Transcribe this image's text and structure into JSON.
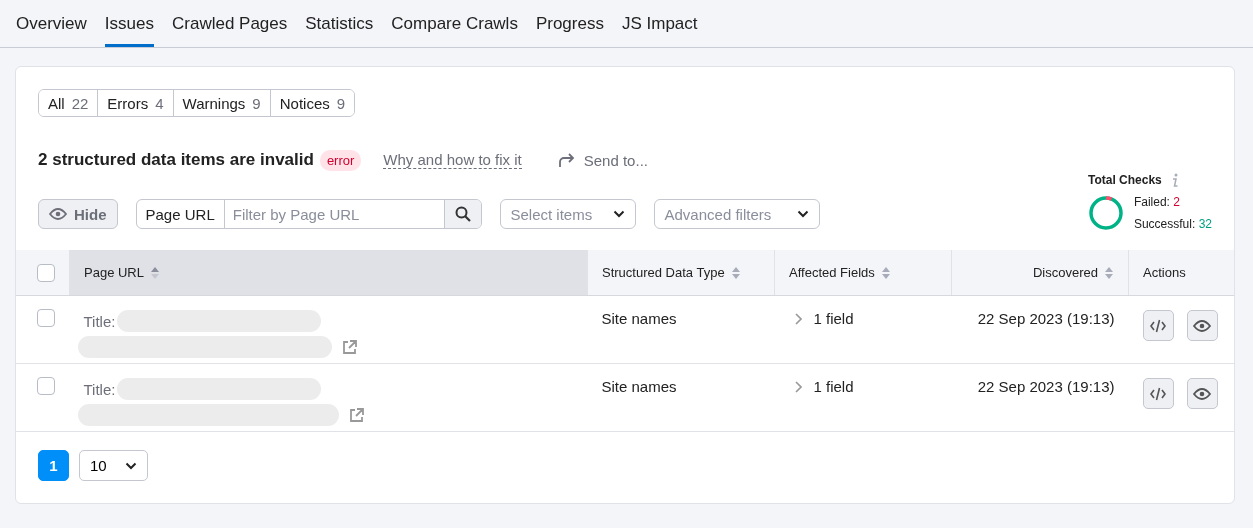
{
  "tabs": [
    {
      "label": "Overview",
      "selected": false
    },
    {
      "label": "Issues",
      "selected": true
    },
    {
      "label": "Crawled Pages",
      "selected": false
    },
    {
      "label": "Statistics",
      "selected": false
    },
    {
      "label": "Compare Crawls",
      "selected": false
    },
    {
      "label": "Progress",
      "selected": false
    },
    {
      "label": "JS Impact",
      "selected": false
    }
  ],
  "segments": [
    {
      "label": "All",
      "count": "22",
      "selected": false
    },
    {
      "label": "Errors",
      "count": "4",
      "selected": false
    },
    {
      "label": "Warnings",
      "count": "9",
      "selected": false
    },
    {
      "label": "Notices",
      "count": "9",
      "selected": false
    }
  ],
  "issue": {
    "title": "2 structured data items are invalid",
    "badge": "error",
    "help_link": "Why and how to fix it",
    "send_to": "Send to..."
  },
  "filters": {
    "hide_button": "Hide",
    "url_filter_label": "Page URL",
    "url_filter_placeholder": "Filter by Page URL",
    "select_placeholder": "Select items",
    "advanced_filters": "Advanced filters"
  },
  "total_checks": {
    "title": "Total Checks",
    "failed_label": "Failed:",
    "failed": "2",
    "successful_label": "Successful:",
    "successful": "32"
  },
  "table": {
    "columns": [
      {
        "label": "Page URL",
        "sortable": true,
        "active": true
      },
      {
        "label": "Structured Data Type",
        "sortable": true,
        "active": false
      },
      {
        "label": "Affected Fields",
        "sortable": true,
        "active": false
      },
      {
        "label": "Discovered",
        "sortable": true,
        "active": false
      },
      {
        "label": "Actions",
        "sortable": false,
        "active": false
      }
    ],
    "header_checked": false,
    "rows": [
      {
        "checked": false,
        "title_label": "Title:",
        "type": "Site names",
        "fields": "1 field",
        "discovered": "22 Sep 2023 (19:13)"
      },
      {
        "checked": false,
        "title_label": "Title:",
        "type": "Site names",
        "fields": "1 field",
        "discovered": "22 Sep 2023 (19:13)"
      }
    ]
  },
  "pagination": {
    "pages": [
      {
        "label": "1",
        "selected": true
      }
    ],
    "page_size": "10"
  }
}
